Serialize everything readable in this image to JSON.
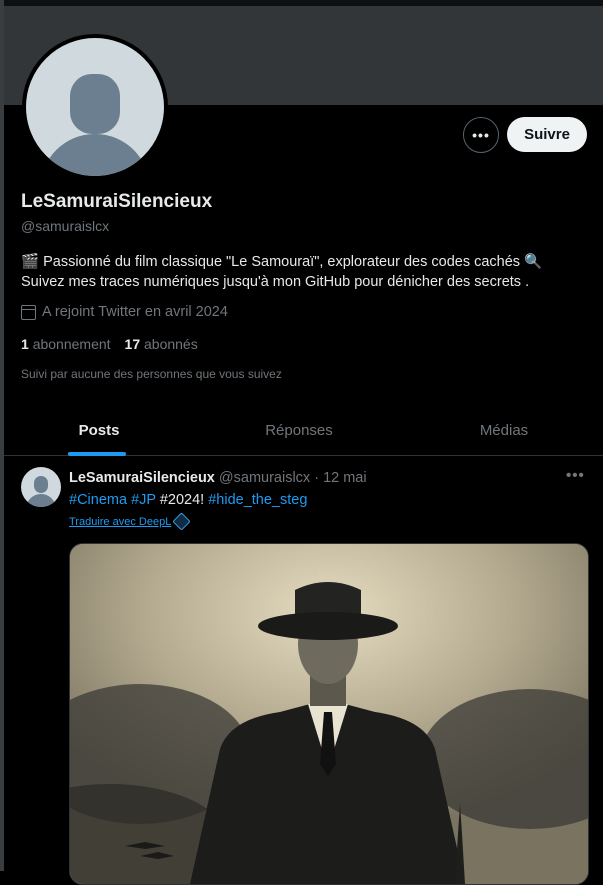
{
  "profile": {
    "display_name": "LeSamuraiSilencieux",
    "handle": "@samuraislcx",
    "bio_line1": "🎬 Passionné du film classique \"Le Samouraï\", explorateur des codes cachés 🔍",
    "bio_line2": "Suivez mes traces numériques jusqu'à mon GitHub pour dénicher des secrets .",
    "joined": "A rejoint Twitter en avril 2024",
    "following_count": "1",
    "following_label": "abonnement",
    "followers_count": "17",
    "followers_label": "abonnés",
    "followed_by": "Suivi par aucune des personnes que vous suivez"
  },
  "actions": {
    "more": "•••",
    "follow": "Suivre"
  },
  "tabs": [
    {
      "label": "Posts",
      "active": true
    },
    {
      "label": "Réponses",
      "active": false
    },
    {
      "label": "Médias",
      "active": false
    }
  ],
  "post": {
    "author_name": "LeSamuraiSilencieux",
    "author_handle": "@samuraislcx",
    "separator": " · ",
    "date": "12 mai",
    "more": "•••",
    "tag1": "#Cinema",
    "tag2": "#JP",
    "plain": "#2024!",
    "tag3": "#hide_the_steg",
    "translate": "Traduire avec DeepL"
  },
  "colors": {
    "accent": "#1d9bf0",
    "background": "#000000",
    "banner": "#333639"
  }
}
